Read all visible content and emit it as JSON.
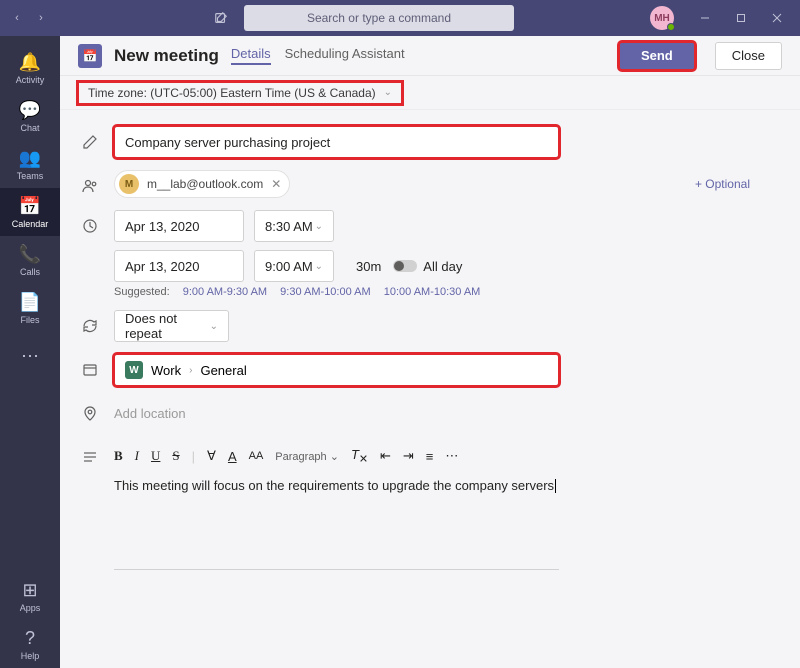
{
  "titlebar": {
    "search_placeholder": "Search or type a command",
    "avatar_initials": "MH"
  },
  "rail": {
    "items": [
      {
        "id": "activity",
        "label": "Activity"
      },
      {
        "id": "chat",
        "label": "Chat"
      },
      {
        "id": "teams",
        "label": "Teams"
      },
      {
        "id": "calendar",
        "label": "Calendar"
      },
      {
        "id": "calls",
        "label": "Calls"
      },
      {
        "id": "files",
        "label": "Files"
      }
    ],
    "apps_label": "Apps",
    "help_label": "Help"
  },
  "header": {
    "title": "New meeting",
    "tabs": {
      "details": "Details",
      "scheduling": "Scheduling Assistant"
    },
    "send": "Send",
    "close": "Close"
  },
  "timezone": "Time zone: (UTC-05:00) Eastern Time (US & Canada)",
  "form": {
    "title_value": "Company server purchasing project",
    "attendee": {
      "initial": "M",
      "email": "m__lab@outlook.com"
    },
    "optional": "+ Optional",
    "start_date": "Apr 13, 2020",
    "start_time": "8:30 AM",
    "end_date": "Apr 13, 2020",
    "end_time": "9:00 AM",
    "duration": "30m",
    "allday": "All day",
    "suggested_label": "Suggested:",
    "suggested_1": "9:00 AM-9:30 AM",
    "suggested_2": "9:30 AM-10:00 AM",
    "suggested_3": "10:00 AM-10:30 AM",
    "repeat": "Does not repeat",
    "channel_group": "Work",
    "channel_name": "General",
    "channel_chip": "W",
    "location_placeholder": "Add location",
    "paragraph": "Paragraph",
    "description": "This meeting will focus on the requirements to upgrade the company servers"
  }
}
